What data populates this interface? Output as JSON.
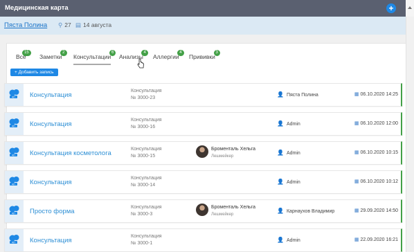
{
  "window": {
    "title": "Медицинская карта",
    "add_label": "+"
  },
  "patient": {
    "name": "Пяста Полина",
    "age": "27",
    "birthday": "14 августа"
  },
  "tabs": [
    {
      "label": "Все",
      "count": "15"
    },
    {
      "label": "Заметки",
      "count": "2"
    },
    {
      "label": "Консультации",
      "count": "6"
    },
    {
      "label": "Анализы",
      "count": "4"
    },
    {
      "label": "Аллергии",
      "count": "4"
    },
    {
      "label": "Прививки",
      "count": "3"
    }
  ],
  "active_tab": "Консультации",
  "add_record_label": "+ Добавить запись",
  "records": [
    {
      "title": "Консультация",
      "kind": "Консультация",
      "number": "№ 3000-23",
      "doctor": "",
      "doctor_role": "",
      "author": "Пяста Полина",
      "date": "06.10.2020 14:25"
    },
    {
      "title": "Консультация",
      "kind": "Консультация",
      "number": "№ 3000-16",
      "doctor": "",
      "doctor_role": "",
      "author": "Admin",
      "date": "06.10.2020 12:00"
    },
    {
      "title": "Консультация косметолога",
      "kind": "Консультация",
      "number": "№ 3000-15",
      "doctor": "Броменталь Хельга",
      "doctor_role": "Лешмейкер",
      "author": "Admin",
      "date": "06.10.2020 10:15"
    },
    {
      "title": "Консультация",
      "kind": "Консультация",
      "number": "№ 3000-14",
      "doctor": "",
      "doctor_role": "",
      "author": "Admin",
      "date": "06.10.2020 10:12"
    },
    {
      "title": "Просто форма",
      "kind": "Консультация",
      "number": "№ 3000-3",
      "doctor": "Броменталь Хельга",
      "doctor_role": "Лешмейкер",
      "author": "Карнаухов Владимир",
      "date": "29.09.2020 14:50"
    },
    {
      "title": "Консультация",
      "kind": "Консультация",
      "number": "№ 3000-1",
      "doctor": "",
      "doctor_role": "",
      "author": "Admin",
      "date": "22.09.2020 16:21"
    }
  ],
  "colors": {
    "accent": "#1e88e5",
    "badge": "#43a047",
    "link": "#2d8fd5",
    "header": "#5a6070"
  },
  "icons": {
    "age": "location-pin-icon",
    "birthday": "cake-icon",
    "author": "user-icon",
    "date": "calendar-icon",
    "record": "chat-bubbles-icon"
  }
}
